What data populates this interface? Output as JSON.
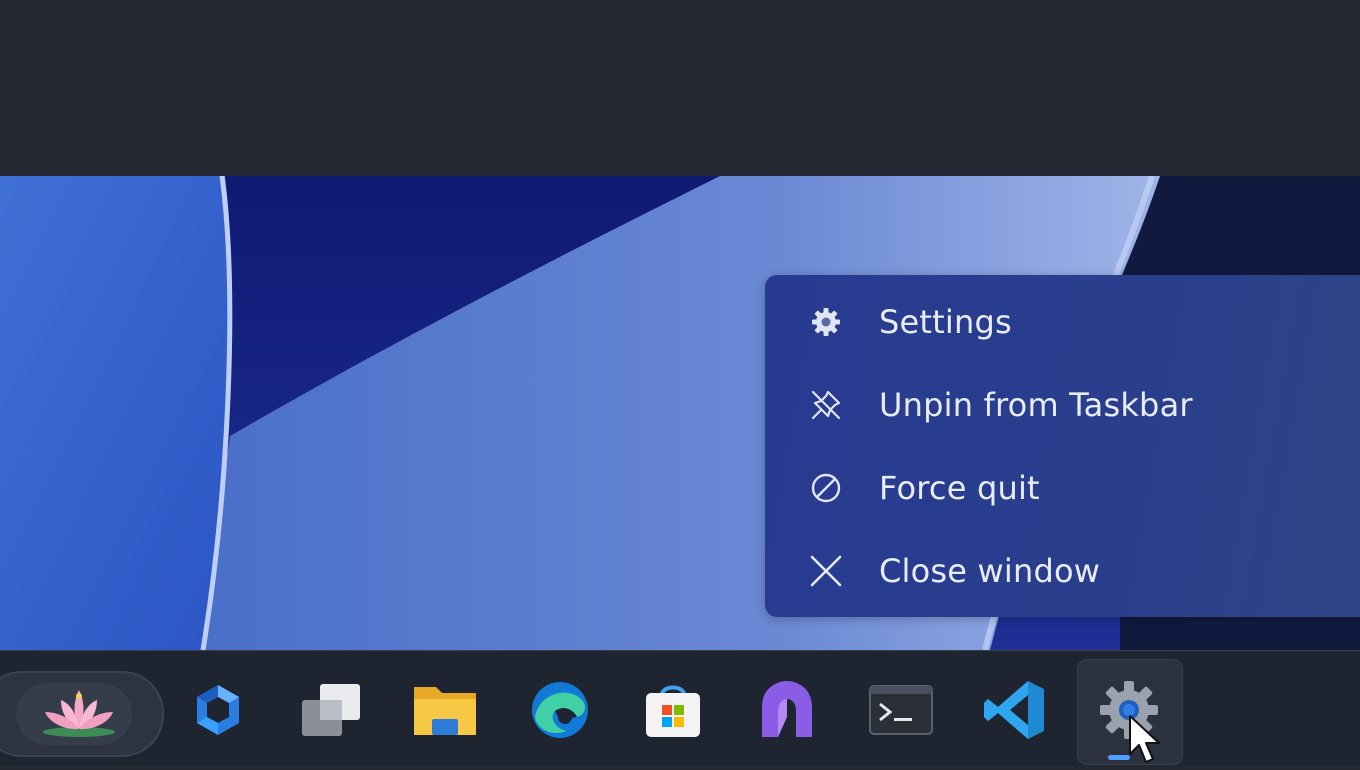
{
  "context_menu": {
    "items": [
      {
        "label": "Settings",
        "icon": "gear-icon"
      },
      {
        "label": "Unpin from Taskbar",
        "icon": "unpin-icon"
      },
      {
        "label": "Force quit",
        "icon": "prohibited-icon"
      },
      {
        "label": "Close window",
        "icon": "close-icon"
      }
    ]
  },
  "taskbar": {
    "apps": [
      {
        "icon": "lotus-icon"
      },
      {
        "icon": "copilot-icon"
      },
      {
        "icon": "task-view-icon"
      },
      {
        "icon": "file-explorer-icon"
      },
      {
        "icon": "edge-icon"
      },
      {
        "icon": "store-icon"
      },
      {
        "icon": "arc-icon"
      },
      {
        "icon": "terminal-icon"
      },
      {
        "icon": "vscode-icon"
      },
      {
        "icon": "settings-app-icon",
        "active": true
      }
    ]
  },
  "colors": {
    "menu_bg": "#273a92",
    "taskbar_bg": "#1e2430",
    "top_bar_bg": "#242833",
    "menu_text": "#e8ecf7"
  }
}
